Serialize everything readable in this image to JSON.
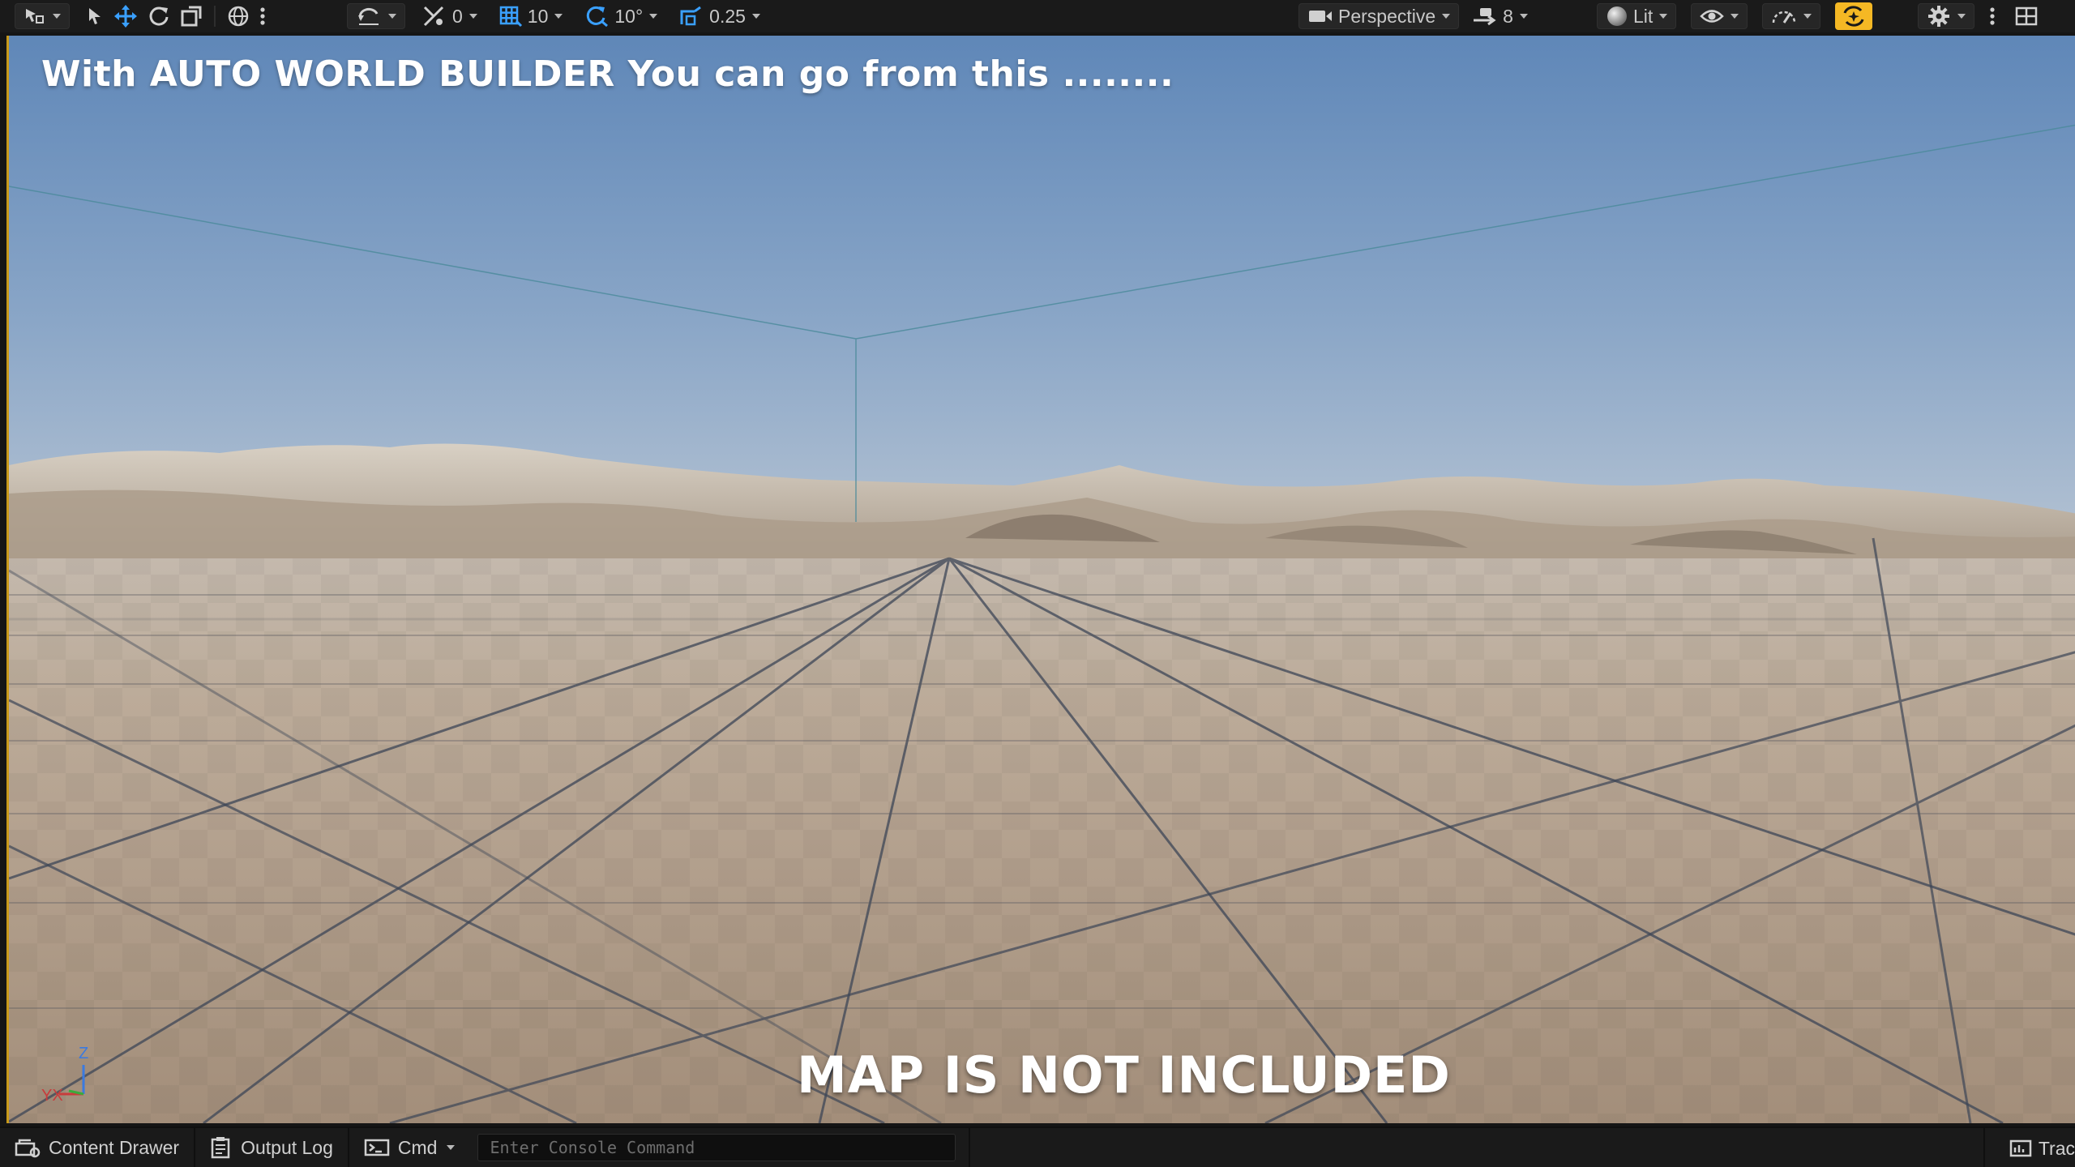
{
  "toolbar": {
    "translate_snap_value": "0",
    "grid_snap_value": "10",
    "rotation_snap_value": "10°",
    "scale_snap_value": "0.25",
    "view_mode_label": "Perspective",
    "camera_speed_value": "8",
    "lighting_mode_label": "Lit",
    "accent_color": "#f5b824"
  },
  "viewport": {
    "title_text": "With AUTO WORLD BUILDER You can go from this ........",
    "notice_text": "MAP IS NOT INCLUDED",
    "gizmo_axis_z": "Z",
    "gizmo_axis_xy": "YX"
  },
  "statusbar": {
    "content_drawer_label": "Content Drawer",
    "output_log_label": "Output Log",
    "cmd_label": "Cmd",
    "console_placeholder": "Enter Console Command",
    "trace_label": "Trac"
  }
}
